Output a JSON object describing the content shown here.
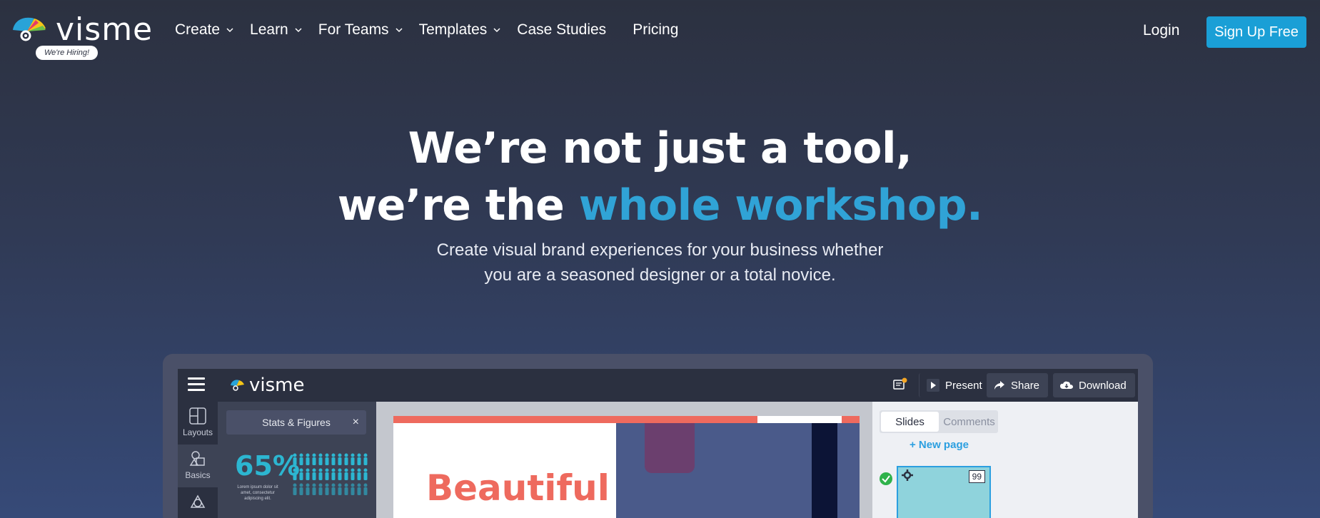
{
  "nav": {
    "logo_text": "visme",
    "hiring_badge": "We're Hiring!",
    "items": [
      {
        "label": "Create",
        "has_dropdown": true
      },
      {
        "label": "Learn",
        "has_dropdown": true
      },
      {
        "label": "For Teams",
        "has_dropdown": true
      },
      {
        "label": "Templates",
        "has_dropdown": true
      },
      {
        "label": "Case Studies",
        "has_dropdown": false
      },
      {
        "label": "Pricing",
        "has_dropdown": false
      }
    ],
    "login": "Login",
    "signup": "Sign Up Free"
  },
  "hero": {
    "line1": "We’re not just a tool,",
    "line2_plain": "we’re the ",
    "line2_accent": "whole workshop.",
    "subtitle_line1": "Create visual brand experiences for your business whether",
    "subtitle_line2": "you are a seasoned designer or a total novice."
  },
  "app": {
    "logo_text": "visme",
    "toolbar": {
      "present": "Present",
      "share": "Share",
      "download": "Download"
    },
    "rail": [
      {
        "label": "Layouts",
        "icon": "layouts-icon"
      },
      {
        "label": "Basics",
        "icon": "basics-icon"
      }
    ],
    "panel": {
      "title": "Stats & Figures",
      "close": "×",
      "stat": "65%",
      "caption": "Lorem ipsum dolor sit amet, consectetur adipiscing elit."
    },
    "canvas": {
      "title": "Beautiful"
    },
    "right": {
      "tabs": [
        "Slides",
        "Comments"
      ],
      "new_page": "+ New page",
      "slide_number": "99"
    }
  },
  "colors": {
    "accent": "#30a3d6",
    "signup_bg": "#1a9fd6",
    "stat": "#2cb6d1",
    "coral": "#ee6a5e"
  }
}
